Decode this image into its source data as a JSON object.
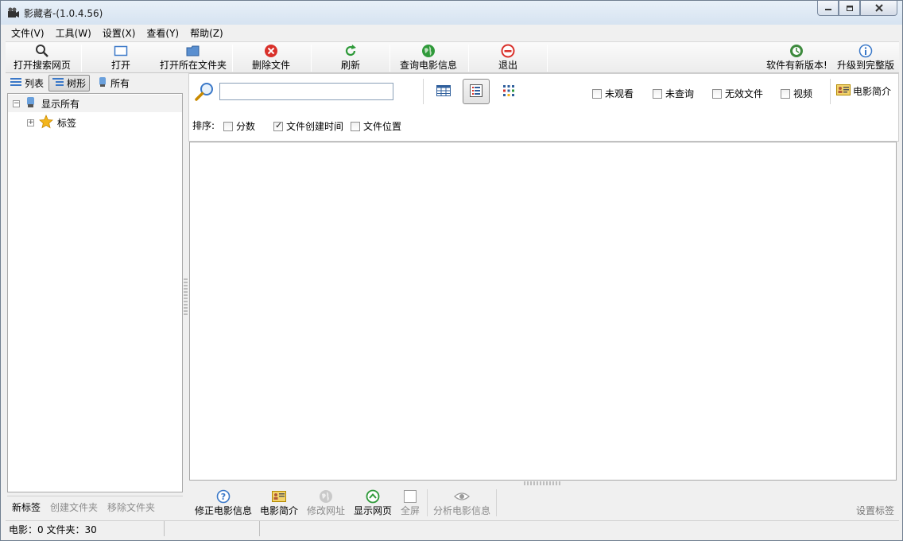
{
  "window": {
    "title": "影藏者-(1.0.4.56)"
  },
  "menu": [
    "文件(V)",
    "工具(W)",
    "设置(X)",
    "查看(Y)",
    "帮助(Z)"
  ],
  "toolbar": {
    "open_search_page": "打开搜索网页",
    "open": "打开",
    "open_folder": "打开所在文件夹",
    "delete_file": "删除文件",
    "refresh": "刷新",
    "query_movie_info": "查询电影信息",
    "exit": "退出",
    "new_version": "软件有新版本!",
    "upgrade_full": "升级到完整版"
  },
  "left": {
    "view_list": "列表",
    "view_tree": "树形",
    "view_all": "所有",
    "tree": {
      "show_all": "显示所有",
      "tags": "标签"
    },
    "actions": {
      "new_tag": "新标签",
      "create_folder": "创建文件夹",
      "remove_folder": "移除文件夹"
    }
  },
  "filter": {
    "search_value": "",
    "unwatched": "未观看",
    "unqueried": "未查询",
    "invalid_files": "无效文件",
    "video": "视频",
    "movie_intro": "电影简介",
    "sort_label": "排序:",
    "sort_score": "分数",
    "sort_created": "文件创建时间",
    "sort_location": "文件位置",
    "sort_created_checked": true
  },
  "bottom": {
    "fix_movie_info": "修正电影信息",
    "movie_intro": "电影简介",
    "edit_url": "修改网址",
    "show_webpage": "显示网页",
    "fullscreen": "全屏",
    "analyze_movie_info": "分析电影信息",
    "set_tags": "设置标签"
  },
  "status": {
    "counts": "电影：0 文件夹：30"
  },
  "colors": {
    "accent_blue": "#3a78c8",
    "delete_red": "#d9312b",
    "refresh_green": "#2f9a3a"
  }
}
